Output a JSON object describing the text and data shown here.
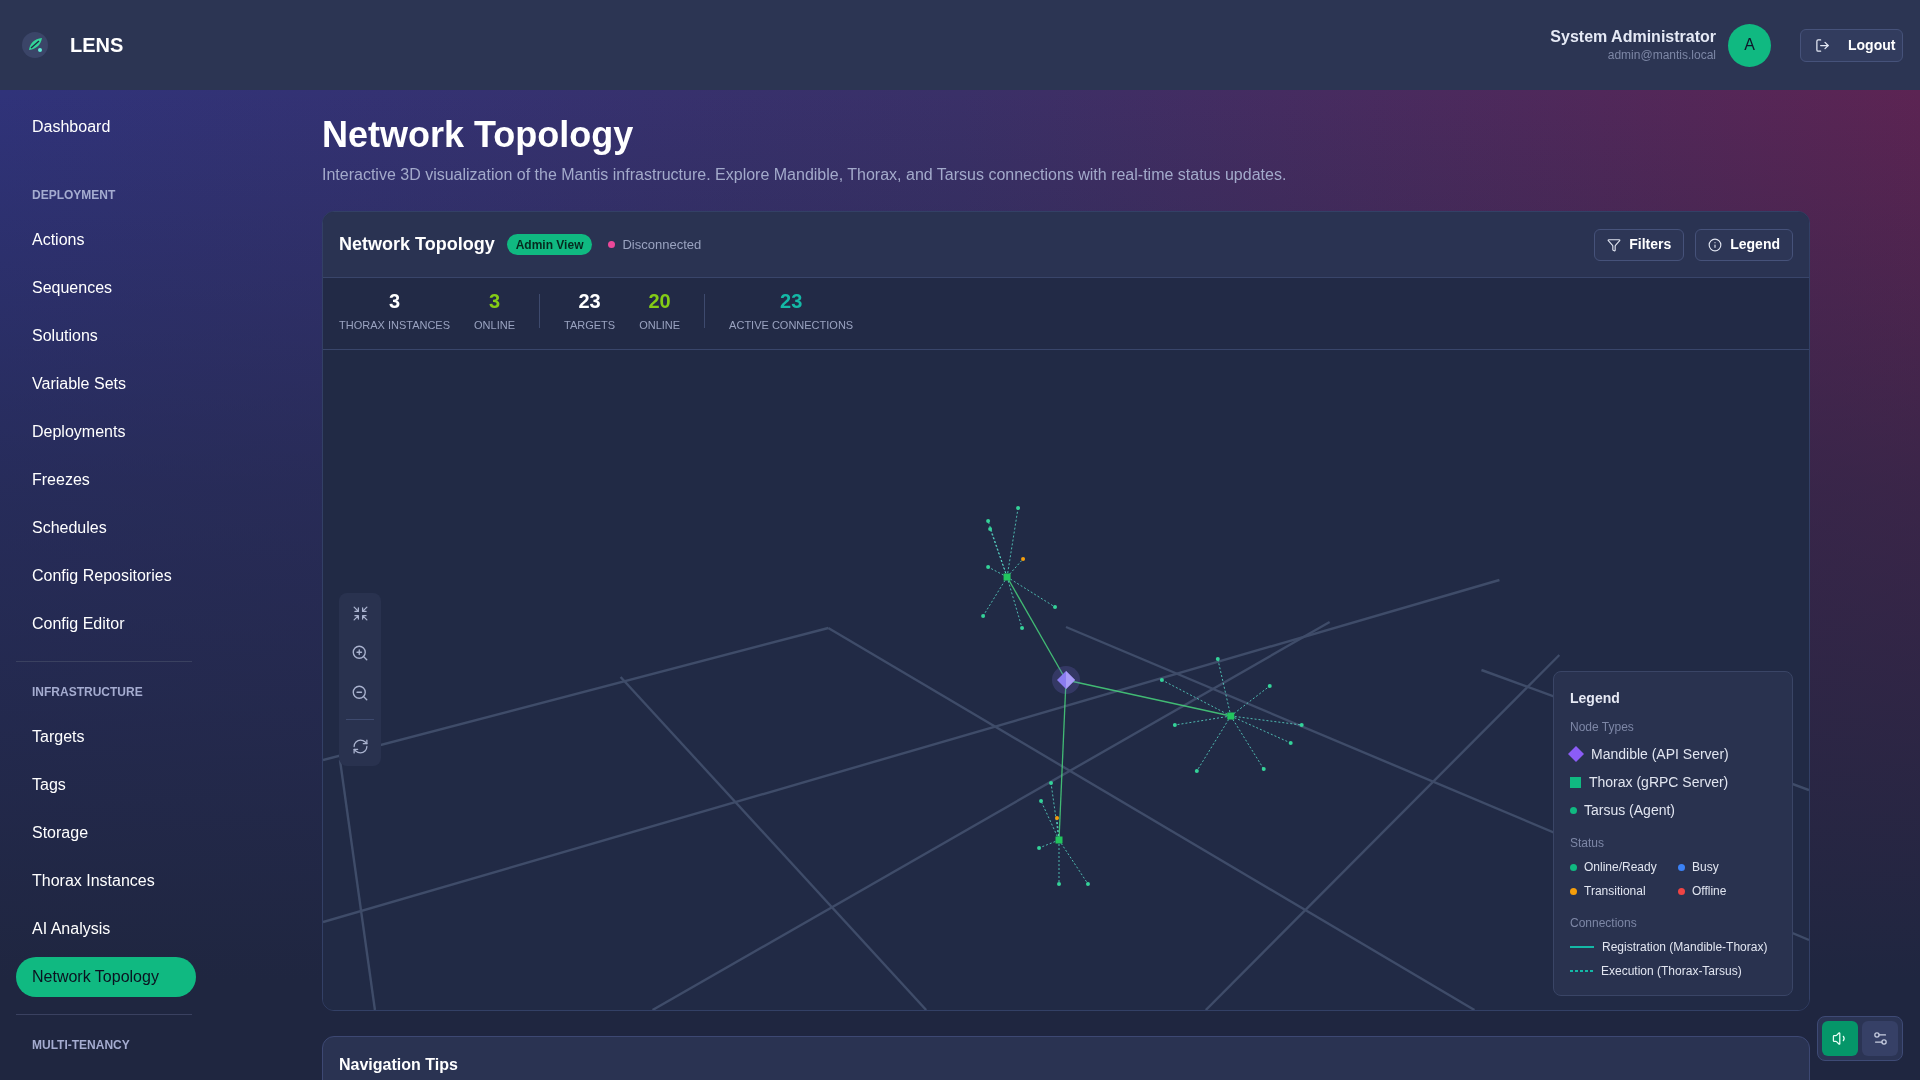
{
  "header": {
    "brand": "LENS",
    "user": {
      "name": "System Administrator",
      "email": "admin@mantis.local",
      "avatar_initial": "A"
    },
    "logout_label": "Logout"
  },
  "sidebar": {
    "sections": [
      {
        "items": [
          {
            "label": "Dashboard",
            "selected": false
          }
        ]
      },
      {
        "divider_above": false,
        "heading": "DEPLOYMENT",
        "items": [
          {
            "label": "Actions",
            "selected": false
          },
          {
            "label": "Sequences",
            "selected": false
          },
          {
            "label": "Solutions",
            "selected": false
          },
          {
            "label": "Variable Sets",
            "selected": false
          },
          {
            "label": "Deployments",
            "selected": false
          },
          {
            "label": "Freezes",
            "selected": false
          },
          {
            "label": "Schedules",
            "selected": false
          },
          {
            "label": "Config Repositories",
            "selected": false
          },
          {
            "label": "Config Editor",
            "selected": false
          }
        ]
      },
      {
        "divider_above": true,
        "heading": "INFRASTRUCTURE",
        "items": [
          {
            "label": "Targets",
            "selected": false
          },
          {
            "label": "Tags",
            "selected": false
          },
          {
            "label": "Storage",
            "selected": false
          },
          {
            "label": "Thorax Instances",
            "selected": false
          },
          {
            "label": "AI Analysis",
            "selected": false
          },
          {
            "label": "Network Topology",
            "selected": true
          }
        ]
      },
      {
        "divider_above": true,
        "heading": "MULTI-TENANCY"
      }
    ]
  },
  "page": {
    "title": "Network Topology",
    "subtitle": "Interactive 3D visualization of the Mantis infrastructure. Explore Mandible, Thorax, and Tarsus connections with real-time status updates."
  },
  "panel": {
    "title": "Network Topology",
    "badge": "Admin View",
    "connection": {
      "label": "Disconnected",
      "connected": false
    },
    "buttons": [
      {
        "label": "Filters",
        "kind": "filter"
      },
      {
        "label": "Legend",
        "kind": "info"
      }
    ],
    "stat_groups": [
      {
        "stats": [
          {
            "value": "3",
            "label": "THORAX INSTANCES",
            "kind": "total"
          },
          {
            "value": "3",
            "label": "ONLINE",
            "kind": "online"
          }
        ]
      },
      {
        "stats": [
          {
            "value": "23",
            "label": "TARGETS",
            "kind": "total"
          },
          {
            "value": "20",
            "label": "ONLINE",
            "kind": "online"
          }
        ]
      },
      {
        "stats": [
          {
            "value": "23",
            "label": "ACTIVE CONNECTIONS",
            "kind": "connections"
          }
        ]
      }
    ],
    "legend": {
      "title": "Legend",
      "sections": [
        {
          "heading": "Node Types",
          "kind": "list",
          "items": [
            {
              "label": "Mandible (API Server)",
              "kind": "diamond",
              "color": "#8b5cf6"
            },
            {
              "label": "Thorax (gRPC Server)",
              "kind": "square",
              "color": "#10b981"
            },
            {
              "label": "Tarsus (Agent)",
              "kind": "dot",
              "color": "#10b981"
            }
          ]
        },
        {
          "heading": "Status",
          "kind": "grid",
          "items": [
            {
              "label": "Online/Ready",
              "kind": "dot",
              "color": "#10b981"
            },
            {
              "label": "Busy",
              "kind": "dot",
              "color": "#3b82f6"
            },
            {
              "label": "Transitional",
              "kind": "dot",
              "color": "#f59e0b"
            },
            {
              "label": "Offline",
              "kind": "dot",
              "color": "#ef4444"
            }
          ]
        },
        {
          "heading": "Connections",
          "kind": "list",
          "items": [
            {
              "label": "Registration (Mandible-Thorax)",
              "kind": "solid_line"
            },
            {
              "label": "Execution (Thorax-Tarsus)",
              "kind": "dashed_line"
            }
          ]
        }
      ]
    }
  },
  "navigation_tips": {
    "title": "Navigation Tips"
  },
  "sound": {
    "on": true
  }
}
